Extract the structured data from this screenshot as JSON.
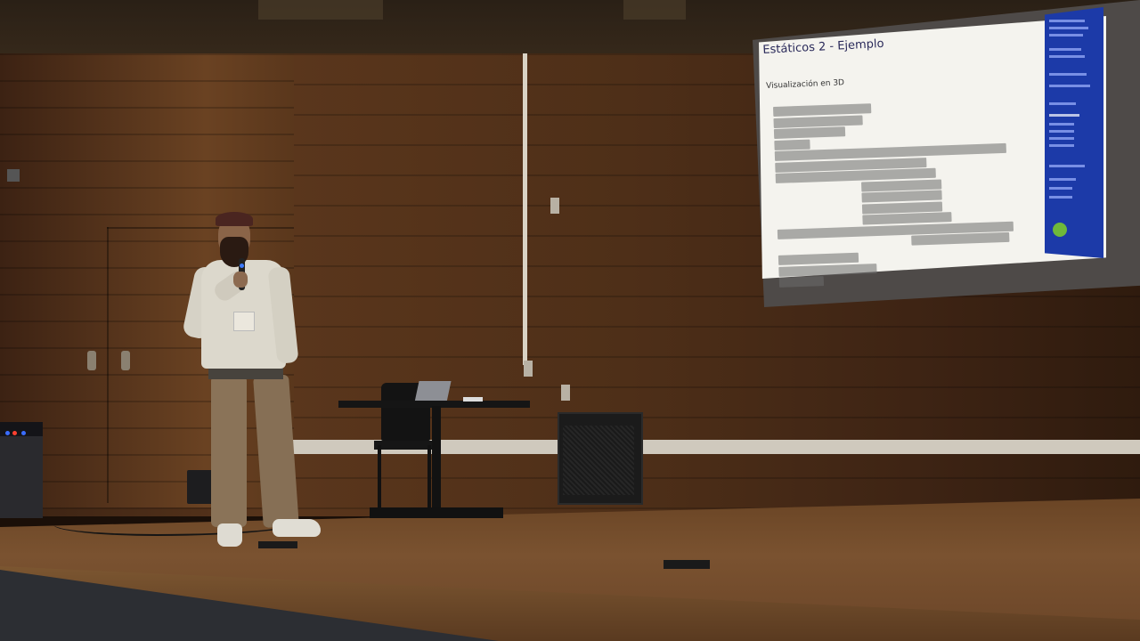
{
  "scene": {
    "description_colors": {
      "wall": "#5a361c",
      "stage": "#7a5230",
      "slide_bg": "#f4f3ee",
      "slide_sidebar": "#1c3aa8",
      "mic_light": "#3d7bff"
    }
  },
  "slide": {
    "title": "Estáticos 2 - Ejemplo",
    "subtitle": "Visualización en 3D"
  }
}
